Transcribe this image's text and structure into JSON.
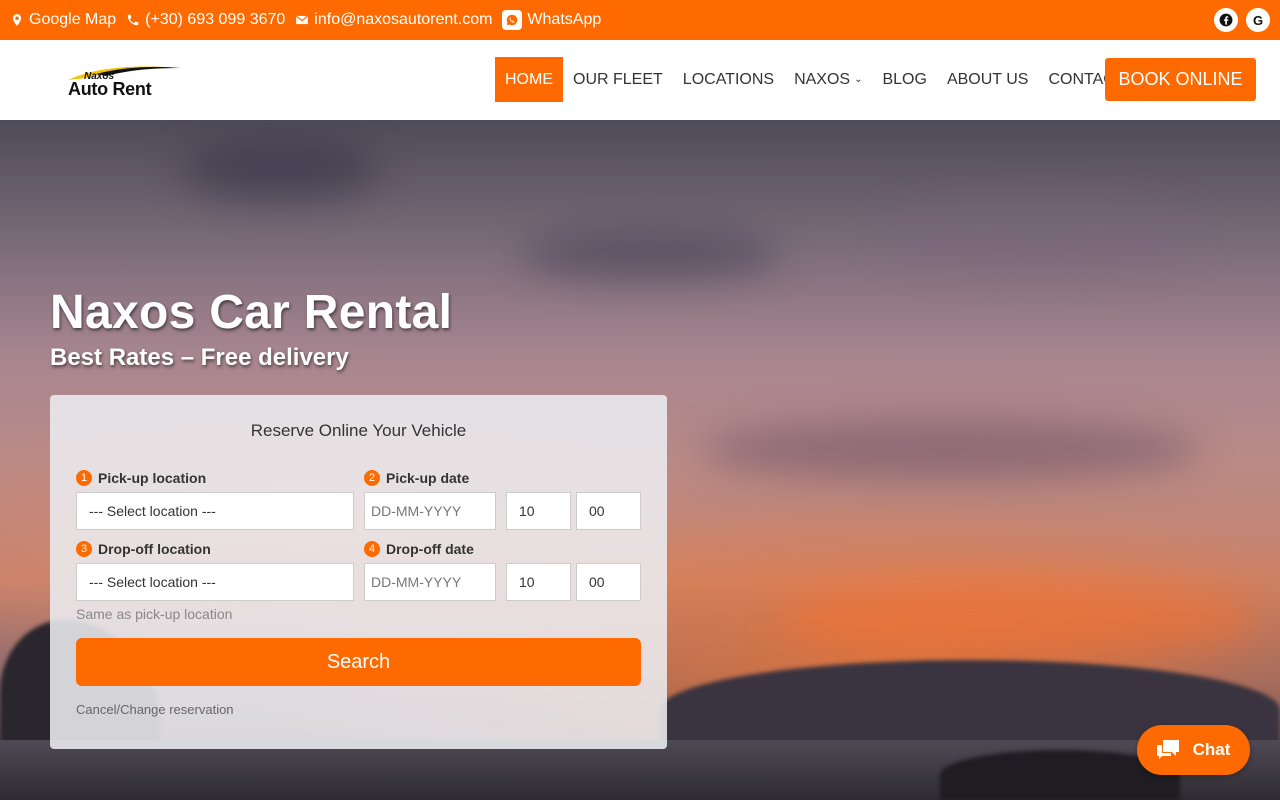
{
  "topbar": {
    "google_map": "Google Map",
    "phone": "(+30) 693 099 3670",
    "email": "info@naxosautorent.com",
    "whatsapp": "WhatsApp",
    "socials": [
      "facebook-icon",
      "google-icon"
    ]
  },
  "logo": {
    "small": "Naxos",
    "big": "Auto Rent"
  },
  "nav": {
    "items": [
      {
        "label": "HOME"
      },
      {
        "label": "OUR FLEET"
      },
      {
        "label": "LOCATIONS"
      },
      {
        "label": "NAXOS"
      },
      {
        "label": "BLOG"
      },
      {
        "label": "ABOUT US"
      },
      {
        "label": "CONTACT"
      }
    ],
    "book": "BOOK ONLINE"
  },
  "hero": {
    "title": "Naxos Car Rental",
    "subtitle": "Best Rates – Free delivery"
  },
  "booking": {
    "title": "Reserve Online Your Vehicle",
    "pickup_location_label": "Pick-up location",
    "pickup_date_label": "Pick-up date",
    "dropoff_location_label": "Drop-off location",
    "dropoff_date_label": "Drop-off date",
    "location_placeholder": "--- Select location ---",
    "date_placeholder": "DD-MM-YYYY",
    "pickup_hour": "10",
    "pickup_minute": "00",
    "dropoff_hour": "10",
    "dropoff_minute": "00",
    "same_as_pickup": "Same as pick-up location",
    "search": "Search",
    "cancel": "Cancel/Change reservation",
    "numbers": [
      "1",
      "2",
      "3",
      "4"
    ]
  },
  "chat": {
    "label": "Chat"
  },
  "colors": {
    "accent": "#ff6a00"
  }
}
